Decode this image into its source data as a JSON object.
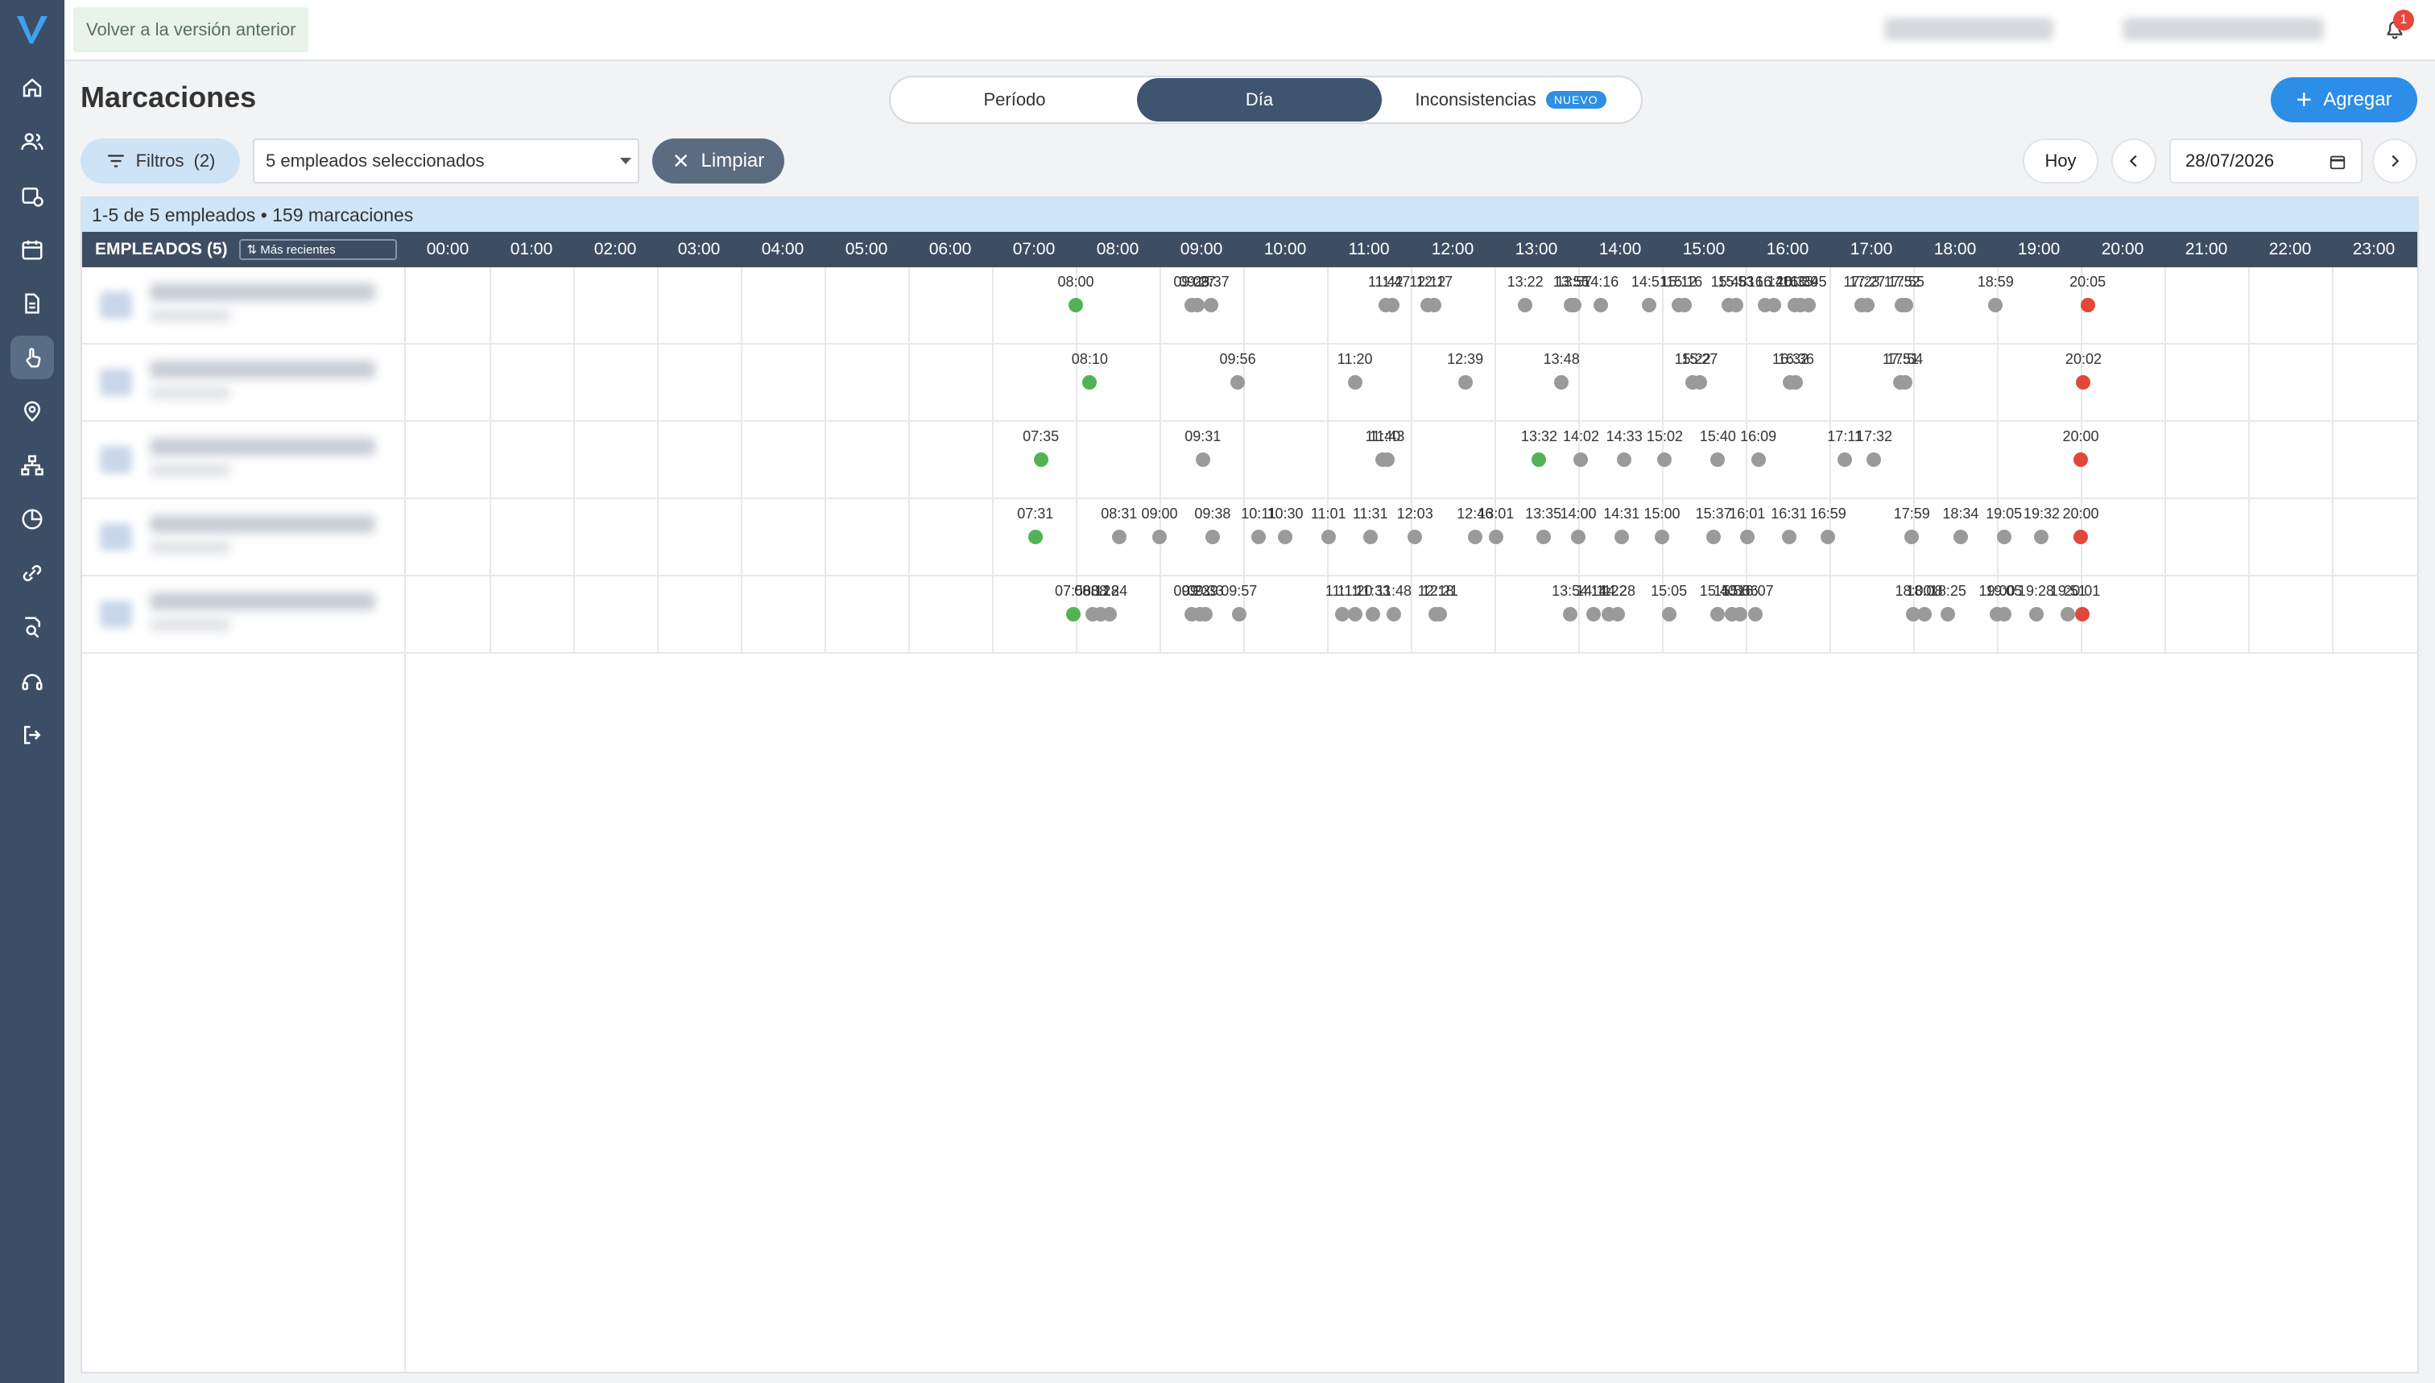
{
  "sidebar": {
    "logo": "V",
    "items": [
      {
        "name": "home-icon"
      },
      {
        "name": "users-icon"
      },
      {
        "name": "calendar-clock-icon"
      },
      {
        "name": "calendar-icon"
      },
      {
        "name": "document-icon"
      },
      {
        "name": "hand-touch-icon",
        "active": true
      },
      {
        "name": "location-pin-icon"
      },
      {
        "name": "org-chart-icon"
      },
      {
        "name": "pie-chart-icon"
      },
      {
        "name": "link-icon"
      },
      {
        "name": "search-report-icon"
      },
      {
        "name": "support-icon"
      },
      {
        "name": "logout-icon"
      }
    ]
  },
  "topbar": {
    "back_label": "Volver a la versión anterior",
    "notifications_count": "1"
  },
  "page": {
    "title": "Marcaciones",
    "tabs": [
      {
        "label": "Período"
      },
      {
        "label": "Día",
        "active": true
      },
      {
        "label": "Inconsistencias",
        "badge": "NUEVO"
      }
    ],
    "add_label": "Agregar"
  },
  "filters": {
    "filter_label": "Filtros",
    "filter_count": "(2)",
    "employees_selected": "5 empleados seleccionados",
    "clear_label": "Limpiar",
    "today_label": "Hoy",
    "date_value": "28/07/2026"
  },
  "grid": {
    "summary": "1-5 de 5 empleados • 159 marcaciones",
    "employees_header": "EMPLEADOS (5)",
    "sort_label": "Más recientes",
    "hours": [
      "00:00",
      "01:00",
      "02:00",
      "03:00",
      "04:00",
      "05:00",
      "06:00",
      "07:00",
      "08:00",
      "09:00",
      "10:00",
      "11:00",
      "12:00",
      "13:00",
      "14:00",
      "15:00",
      "16:00",
      "17:00",
      "18:00",
      "19:00",
      "20:00",
      "21:00",
      "22:00",
      "23:00"
    ],
    "rows": [
      {
        "punches": [
          {
            "time": "08:00",
            "type": "in"
          },
          {
            "time": "09:23",
            "type": "mid"
          },
          {
            "time": "09:27",
            "type": "mid"
          },
          {
            "time": "09:37",
            "type": "mid"
          },
          {
            "time": "11:42",
            "type": "mid"
          },
          {
            "time": "11:47",
            "type": "mid"
          },
          {
            "time": "12:12",
            "type": "mid"
          },
          {
            "time": "12:17",
            "type": "mid"
          },
          {
            "time": "13:22",
            "type": "mid"
          },
          {
            "time": "13:55",
            "type": "mid"
          },
          {
            "time": "13:57",
            "type": "mid"
          },
          {
            "time": "14:16",
            "type": "mid"
          },
          {
            "time": "14:51",
            "type": "mid"
          },
          {
            "time": "15:12",
            "type": "mid"
          },
          {
            "time": "15:16",
            "type": "mid"
          },
          {
            "time": "15:48",
            "type": "mid"
          },
          {
            "time": "15:53",
            "type": "mid"
          },
          {
            "time": "16:14",
            "type": "mid"
          },
          {
            "time": "16:20",
            "type": "mid"
          },
          {
            "time": "16:35",
            "type": "mid"
          },
          {
            "time": "16:39",
            "type": "mid"
          },
          {
            "time": "16:45",
            "type": "mid"
          },
          {
            "time": "17:23",
            "type": "mid"
          },
          {
            "time": "17:27",
            "type": "mid"
          },
          {
            "time": "17:52",
            "type": "mid"
          },
          {
            "time": "17:55",
            "type": "mid"
          },
          {
            "time": "18:59",
            "type": "mid"
          },
          {
            "time": "20:05",
            "type": "out"
          }
        ]
      },
      {
        "punches": [
          {
            "time": "08:10",
            "type": "in"
          },
          {
            "time": "09:56",
            "type": "mid"
          },
          {
            "time": "11:20",
            "type": "mid"
          },
          {
            "time": "12:39",
            "type": "mid"
          },
          {
            "time": "13:48",
            "type": "mid"
          },
          {
            "time": "15:22",
            "type": "mid"
          },
          {
            "time": "15:27",
            "type": "mid"
          },
          {
            "time": "16:32",
            "type": "mid"
          },
          {
            "time": "16:36",
            "type": "mid"
          },
          {
            "time": "17:51",
            "type": "mid"
          },
          {
            "time": "17:54",
            "type": "mid"
          },
          {
            "time": "20:02",
            "type": "out"
          }
        ]
      },
      {
        "punches": [
          {
            "time": "07:35",
            "type": "in"
          },
          {
            "time": "09:31",
            "type": "mid"
          },
          {
            "time": "11:40",
            "type": "mid"
          },
          {
            "time": "11:43",
            "type": "mid"
          },
          {
            "time": "13:32",
            "type": "in"
          },
          {
            "time": "14:02",
            "type": "mid"
          },
          {
            "time": "14:33",
            "type": "mid"
          },
          {
            "time": "15:02",
            "type": "mid"
          },
          {
            "time": "15:40",
            "type": "mid"
          },
          {
            "time": "16:09",
            "type": "mid"
          },
          {
            "time": "17:11",
            "type": "mid"
          },
          {
            "time": "17:32",
            "type": "mid"
          },
          {
            "time": "20:00",
            "type": "out"
          }
        ]
      },
      {
        "punches": [
          {
            "time": "07:31",
            "type": "in"
          },
          {
            "time": "08:31",
            "type": "mid"
          },
          {
            "time": "09:00",
            "type": "mid"
          },
          {
            "time": "09:38",
            "type": "mid"
          },
          {
            "time": "10:11",
            "type": "mid"
          },
          {
            "time": "10:30",
            "type": "mid"
          },
          {
            "time": "11:01",
            "type": "mid"
          },
          {
            "time": "11:31",
            "type": "mid"
          },
          {
            "time": "12:03",
            "type": "mid"
          },
          {
            "time": "12:46",
            "type": "mid"
          },
          {
            "time": "13:01",
            "type": "mid"
          },
          {
            "time": "13:35",
            "type": "mid"
          },
          {
            "time": "14:00",
            "type": "mid"
          },
          {
            "time": "14:31",
            "type": "mid"
          },
          {
            "time": "15:00",
            "type": "mid"
          },
          {
            "time": "15:37",
            "type": "mid"
          },
          {
            "time": "16:01",
            "type": "mid"
          },
          {
            "time": "16:31",
            "type": "mid"
          },
          {
            "time": "16:59",
            "type": "mid"
          },
          {
            "time": "17:59",
            "type": "mid"
          },
          {
            "time": "18:34",
            "type": "mid"
          },
          {
            "time": "19:05",
            "type": "mid"
          },
          {
            "time": "19:32",
            "type": "mid"
          },
          {
            "time": "20:00",
            "type": "out"
          }
        ]
      },
      {
        "punches": [
          {
            "time": "07:58",
            "type": "in"
          },
          {
            "time": "08:12",
            "type": "mid"
          },
          {
            "time": "08:18",
            "type": "mid"
          },
          {
            "time": "08:24",
            "type": "mid"
          },
          {
            "time": "09:23",
            "type": "mid"
          },
          {
            "time": "09:29",
            "type": "mid"
          },
          {
            "time": "09:33",
            "type": "mid"
          },
          {
            "time": "09:57",
            "type": "mid"
          },
          {
            "time": "11:11",
            "type": "mid"
          },
          {
            "time": "11:20",
            "type": "mid"
          },
          {
            "time": "11:33",
            "type": "mid"
          },
          {
            "time": "11:48",
            "type": "mid"
          },
          {
            "time": "12:18",
            "type": "mid"
          },
          {
            "time": "12:21",
            "type": "mid"
          },
          {
            "time": "13:54",
            "type": "mid"
          },
          {
            "time": "14:11",
            "type": "mid"
          },
          {
            "time": "14:22",
            "type": "mid"
          },
          {
            "time": "14:28",
            "type": "mid"
          },
          {
            "time": "15:05",
            "type": "mid"
          },
          {
            "time": "15:40",
            "type": "mid"
          },
          {
            "time": "15:50",
            "type": "mid"
          },
          {
            "time": "15:56",
            "type": "mid"
          },
          {
            "time": "16:07",
            "type": "mid"
          },
          {
            "time": "18:00",
            "type": "mid"
          },
          {
            "time": "18:08",
            "type": "mid"
          },
          {
            "time": "18:25",
            "type": "mid"
          },
          {
            "time": "19:00",
            "type": "mid"
          },
          {
            "time": "19:05",
            "type": "mid"
          },
          {
            "time": "19:28",
            "type": "mid"
          },
          {
            "time": "19:51",
            "type": "mid"
          },
          {
            "time": "20:01",
            "type": "out"
          }
        ]
      }
    ]
  }
}
